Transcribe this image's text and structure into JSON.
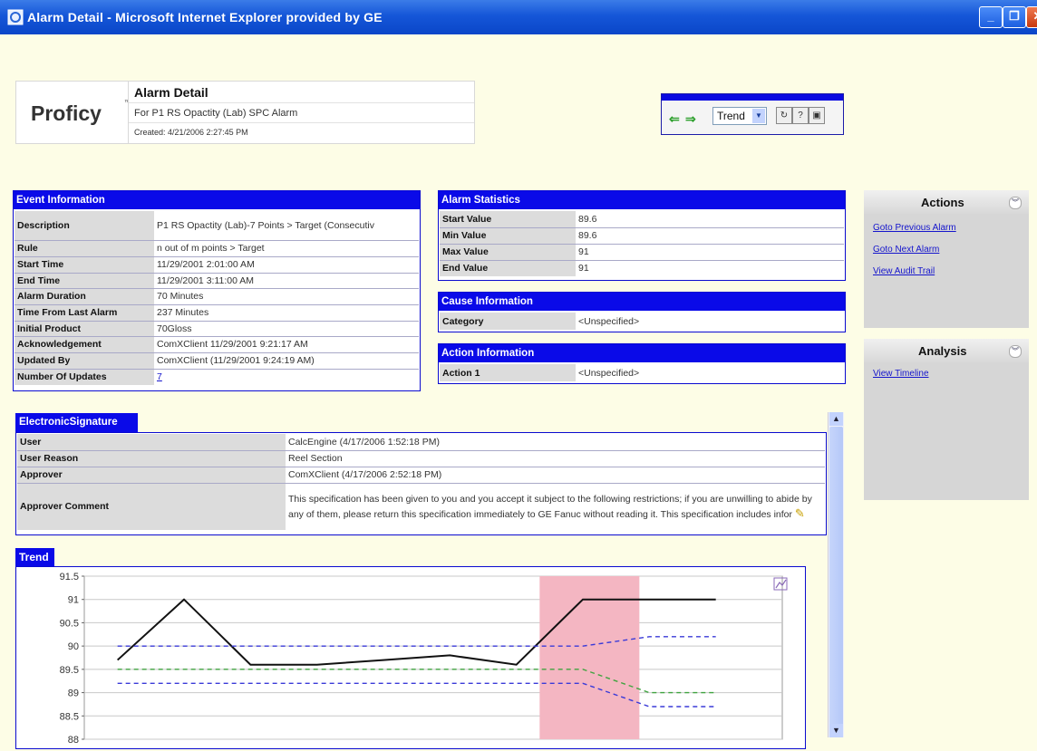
{
  "window": {
    "title": "Alarm Detail - Microsoft Internet Explorer provided by GE"
  },
  "header": {
    "logo": "Proficy",
    "logo_tm": "™",
    "title": "Alarm Detail",
    "subtitle": "For P1 RS Opactity (Lab) SPC Alarm",
    "created": "Created: 4/21/2006 2:27:45 PM"
  },
  "nav": {
    "view_select": "Trend"
  },
  "event_info": {
    "heading": "Event Information",
    "rows": [
      {
        "label": "Description",
        "value": "P1 RS Opactity (Lab)-7 Points > Target (Consecutiv"
      },
      {
        "label": "Rule",
        "value": "n out of m points > Target"
      },
      {
        "label": "Start Time",
        "value": "11/29/2001 2:01:00 AM"
      },
      {
        "label": "End Time",
        "value": "11/29/2001 3:11:00 AM"
      },
      {
        "label": "Alarm Duration",
        "value": "70 Minutes"
      },
      {
        "label": "Time From Last Alarm",
        "value": "237 Minutes"
      },
      {
        "label": "Initial Product",
        "value": "70Gloss"
      },
      {
        "label": "Acknowledgement",
        "value": "ComXClient 11/29/2001 9:21:17 AM"
      },
      {
        "label": "Updated By",
        "value": "ComXClient (11/29/2001 9:24:19 AM)"
      },
      {
        "label": "Number Of Updates",
        "value": "7"
      }
    ]
  },
  "alarm_stats": {
    "heading": "Alarm Statistics",
    "rows": [
      {
        "label": "Start Value",
        "value": "89.6"
      },
      {
        "label": "Min Value",
        "value": "89.6"
      },
      {
        "label": "Max Value",
        "value": "91"
      },
      {
        "label": "End Value",
        "value": "91"
      }
    ]
  },
  "cause_info": {
    "heading": "Cause Information",
    "label": "Category",
    "value": "<Unspecified>"
  },
  "action_info": {
    "heading": "Action Information",
    "label": "Action 1",
    "value": "<Unspecified>"
  },
  "esig": {
    "heading": "ElectronicSignature",
    "rows": [
      {
        "label": "User",
        "value": "CalcEngine (4/17/2006 1:52:18 PM)"
      },
      {
        "label": "User Reason",
        "value": "Reel Section"
      },
      {
        "label": "Approver",
        "value": "ComXClient (4/17/2006 2:52:18 PM)"
      },
      {
        "label": "Approver Comment",
        "value": "This specification has been given to you and you accept it subject to the following restrictions; if you are unwilling to abide by any of them, please return this specification immediately to GE Fanuc without reading it. This specification includes infor"
      }
    ]
  },
  "actions": {
    "heading": "Actions",
    "links": [
      "Goto Previous Alarm",
      "Goto Next Alarm",
      "View Audit Trail"
    ]
  },
  "analysis": {
    "heading": "Analysis",
    "links": [
      "View Timeline"
    ]
  },
  "trend": {
    "heading": "Trend"
  },
  "chart_data": {
    "type": "line",
    "title": "",
    "x": [
      1,
      2,
      3,
      4,
      5,
      6,
      7,
      8,
      9,
      10
    ],
    "ylim": [
      88,
      91.5
    ],
    "yticks": [
      "91.5",
      "91",
      "90.5",
      "90",
      "89.5",
      "89",
      "88.5",
      "88"
    ],
    "grid": true,
    "highlight": {
      "x_start": 7.35,
      "x_end": 8.85,
      "color": "#f4b6c2"
    },
    "series": [
      {
        "style": "solid",
        "color": "#111111",
        "x": [
          1,
          2,
          3,
          4,
          5,
          6,
          7,
          8,
          9,
          10
        ],
        "values": [
          89.7,
          91.0,
          89.6,
          89.6,
          89.7,
          89.8,
          89.6,
          91.0,
          91.0,
          91.0
        ]
      },
      {
        "style": "dashed",
        "color": "#3a3ad8",
        "x": [
          1,
          8,
          9,
          10
        ],
        "values": [
          90.0,
          90.0,
          90.2,
          90.2
        ]
      },
      {
        "style": "dashed",
        "color": "#3fa33f",
        "x": [
          1,
          8,
          9,
          10
        ],
        "values": [
          89.5,
          89.5,
          89.0,
          89.0
        ]
      },
      {
        "style": "dashed",
        "color": "#3a3ad8",
        "x": [
          1,
          8,
          9,
          10
        ],
        "values": [
          89.2,
          89.2,
          88.7,
          88.7
        ]
      }
    ]
  }
}
